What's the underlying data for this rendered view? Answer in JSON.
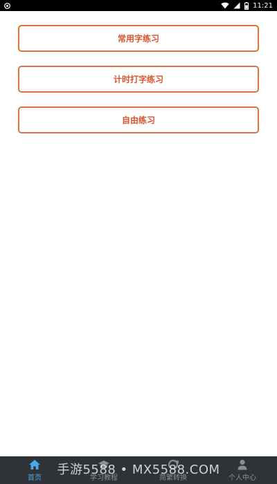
{
  "status_bar": {
    "time": "11:21",
    "icons": [
      "app-notification-icon",
      "wifi-icon",
      "signal-icon",
      "battery-icon"
    ]
  },
  "practice_buttons": [
    {
      "label": "常用字练习"
    },
    {
      "label": "计时打字练习"
    },
    {
      "label": "自由练习"
    }
  ],
  "bottom_nav": {
    "items": [
      {
        "label": "首页",
        "icon": "home-icon",
        "active": true
      },
      {
        "label": "学习教程",
        "icon": "graduation-cap-icon",
        "active": false
      },
      {
        "label": "简繁转换",
        "icon": "convert-icon",
        "active": false
      },
      {
        "label": "个人中心",
        "icon": "user-icon",
        "active": false
      }
    ]
  },
  "watermark": "手游5588 • MX5588.COM",
  "colors": {
    "accent_border": "#d9743a",
    "accent_text": "#d9542e",
    "nav_background": "#2f3338",
    "nav_active": "#4aa8e8",
    "nav_inactive": "#8a8f96"
  }
}
